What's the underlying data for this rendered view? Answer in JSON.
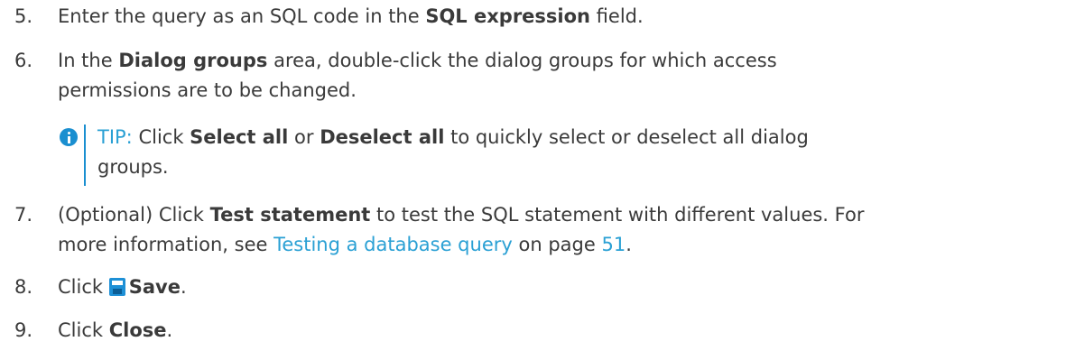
{
  "steps": [
    {
      "number": "5.",
      "text_before": "Enter the query as an SQL code in the ",
      "bold": "SQL expression",
      "text_after": " field."
    },
    {
      "number": "6.",
      "text_before": "In the ",
      "bold": "Dialog groups",
      "text_after": " area, double-click the dialog groups for which access",
      "text_line2": "permissions are to be changed."
    },
    {
      "number": "7.",
      "text_before": "(Optional) Click ",
      "bold": "Test statement",
      "text_after": " to test the SQL statement with different values. For",
      "text_line2_before": "more information, see ",
      "link": "Testing a database query",
      "text_line2_mid": " on page ",
      "page_link": "51",
      "text_line2_after": "."
    },
    {
      "number": "8.",
      "text_before": "Click ",
      "bold": "Save",
      "text_after": ".",
      "icon": "save-icon"
    },
    {
      "number": "9.",
      "text_before": "Click ",
      "bold": "Close",
      "text_after": "."
    }
  ],
  "tip": {
    "icon": "info-icon",
    "label": "TIP:",
    "text_before": " Click ",
    "bold1": "Select all",
    "text_mid": " or ",
    "bold2": "Deselect all",
    "text_after": " to quickly select or deselect all dialog",
    "text_line2": "groups."
  },
  "colors": {
    "text": "#3a3a3a",
    "link": "#2aa0d4",
    "accent": "#1a8fd0"
  }
}
